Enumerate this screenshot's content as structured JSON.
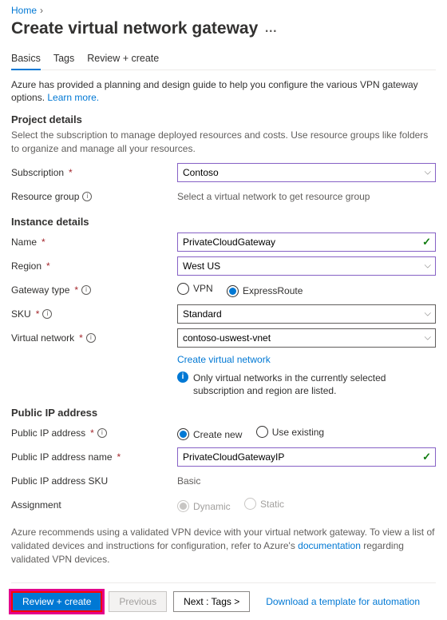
{
  "breadcrumb": {
    "home": "Home"
  },
  "title": "Create virtual network gateway",
  "tabs": [
    {
      "label": "Basics",
      "active": true
    },
    {
      "label": "Tags",
      "active": false
    },
    {
      "label": "Review + create",
      "active": false
    }
  ],
  "intro": {
    "text": "Azure has provided a planning and design guide to help you configure the various VPN gateway options.",
    "learn_more": "Learn more."
  },
  "project": {
    "heading": "Project details",
    "desc": "Select the subscription to manage deployed resources and costs. Use resource groups like folders to organize and manage all your resources.",
    "subscription_label": "Subscription",
    "subscription_value": "Contoso",
    "rg_label": "Resource group",
    "rg_value": "Select a virtual network to get resource group"
  },
  "instance": {
    "heading": "Instance details",
    "name_label": "Name",
    "name_value": "PrivateCloudGateway",
    "region_label": "Region",
    "region_value": "West US",
    "gwtype_label": "Gateway type",
    "gwtype_options": {
      "vpn": "VPN",
      "er": "ExpressRoute"
    },
    "sku_label": "SKU",
    "sku_value": "Standard",
    "vnet_label": "Virtual network",
    "vnet_value": "contoso-uswest-vnet",
    "create_vnet_link": "Create virtual network",
    "vnet_info": "Only virtual networks in the currently selected subscription and region are listed."
  },
  "pip": {
    "heading": "Public IP address",
    "addr_label": "Public IP address",
    "options": {
      "create": "Create new",
      "existing": "Use existing"
    },
    "name_label": "Public IP address name",
    "name_value": "PrivateCloudGatewayIP",
    "sku_label": "Public IP address SKU",
    "sku_value": "Basic",
    "assign_label": "Assignment",
    "assign_options": {
      "dynamic": "Dynamic",
      "static": "Static"
    }
  },
  "recommend": {
    "pre": "Azure recommends using a validated VPN device with your virtual network gateway. To view a list of validated devices and instructions for configuration, refer to Azure's ",
    "link": "documentation",
    "post": " regarding validated VPN devices."
  },
  "footer": {
    "review": "Review + create",
    "previous": "Previous",
    "next": "Next : Tags >",
    "template_link": "Download a template for automation"
  }
}
